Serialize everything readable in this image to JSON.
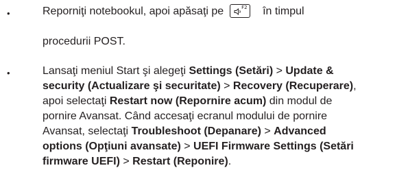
{
  "item1": {
    "line1_before": "Reporniţi notebookul, apoi apăsaţi pe",
    "key_label": "F2",
    "key_icon": "speaker-low-volume-icon",
    "line1_after": "în timpul",
    "line2": "procedurii POST."
  },
  "item2": {
    "t1": "Lansaţi meniul Start şi alegeţi ",
    "b1": "Settings (Setări)",
    "t2": " > ",
    "b2": "Update &",
    "b3": "security (Actualizare şi securitate)",
    "t3": " > ",
    "b4": "Recovery (Recuperare)",
    "t4": ",",
    "t5": "apoi selectaţi ",
    "b5": "Restart now (Repornire acum)",
    "t6": " din modul de",
    "t7": "pornire Avansat. Când accesaţi ecranul modului de pornire",
    "t8": "Avansat, selectaţi ",
    "b6": "Troubleshoot (Depanare)",
    "t9": " > ",
    "b7": "Advanced",
    "b8": "options (Opţiuni avansate)",
    "t10": " > ",
    "b9": "UEFI Firmware Settings (Setări",
    "b10": "firmware UEFI)",
    "t11": " > ",
    "b11": "Restart (Reponire)",
    "t12": "."
  }
}
